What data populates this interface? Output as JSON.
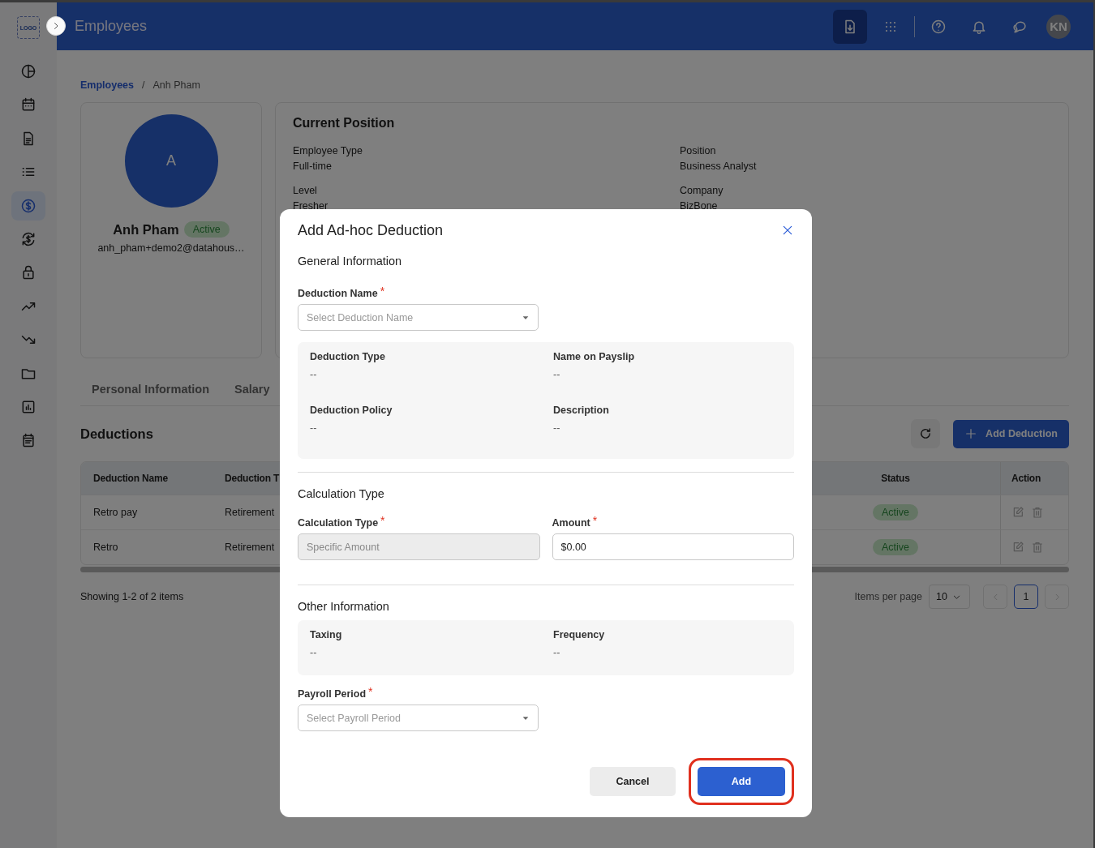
{
  "app": {
    "logo": "LOGO",
    "title": "Employees",
    "avatar": "KN"
  },
  "sidebar": {
    "items": [
      {
        "selected": false
      },
      {
        "selected": false
      },
      {
        "selected": false
      },
      {
        "selected": false
      },
      {
        "selected": true
      },
      {
        "selected": false
      },
      {
        "selected": false
      },
      {
        "selected": false
      },
      {
        "selected": false
      },
      {
        "selected": false
      },
      {
        "selected": false
      },
      {
        "selected": false
      }
    ]
  },
  "breadcrumb": [
    {
      "label": "Employees",
      "kind": "link"
    },
    {
      "label": "/",
      "kind": "separator"
    },
    {
      "label": "Anh Pham",
      "kind": "current"
    }
  ],
  "profile": {
    "initial": "A",
    "name": "Anh Pham",
    "status": "Active",
    "email": "anh_pham+demo2@datahous…"
  },
  "position": {
    "title": "Current Position",
    "fields": [
      {
        "label": "Employee Type",
        "value": "Full-time"
      },
      {
        "label": "Position",
        "value": "Business Analyst"
      },
      {
        "label": "Level",
        "value": "Fresher"
      },
      {
        "label": "Company",
        "value": "BizBone"
      }
    ]
  },
  "tabs": [
    {
      "label": "Personal Information",
      "selected": false
    },
    {
      "label": "Salary",
      "selected": false
    }
  ],
  "deductions": {
    "title": "Deductions",
    "add_button": "Add Deduction",
    "columns": [
      "Deduction Name",
      "Deduction T",
      "Status",
      "Action"
    ],
    "rows": [
      {
        "name": "Retro pay",
        "type": "Retirement",
        "status": "Active"
      },
      {
        "name": "Retro",
        "type": "Retirement",
        "status": "Active"
      }
    ],
    "summary": "Showing 1-2 of 2 items",
    "per_page_label": "Items per page",
    "per_page": "10",
    "pages": [
      {
        "label": "1",
        "selected": true
      }
    ]
  },
  "dialog": {
    "title": "Add Ad-hoc Deduction",
    "sections": [
      {
        "heading": "General Information",
        "blocks": [
          {
            "kind": "field_row",
            "fields": [
              {
                "kind": "select",
                "label": "Deduction Name",
                "mark": "*",
                "placeholder": "Select Deduction Name"
              }
            ]
          },
          {
            "kind": "info_panel",
            "items": [
              {
                "label": "Deduction Type",
                "value": "--"
              },
              {
                "label": "Name on Payslip",
                "value": "--"
              },
              {
                "label": "Deduction Policy",
                "value": "--"
              },
              {
                "label": "Description",
                "value": "--"
              }
            ]
          }
        ]
      },
      {
        "heading": "Calculation Type",
        "blocks": [
          {
            "kind": "field_row",
            "fields": [
              {
                "kind": "input",
                "label": "Calculation Type",
                "mark": "*",
                "value": "Specific Amount",
                "disabled": true
              },
              {
                "kind": "input",
                "label": "Amount",
                "mark": "*",
                "value": "$0.00",
                "disabled": false
              }
            ]
          }
        ]
      },
      {
        "heading": "Other Information",
        "blocks": [
          {
            "kind": "info_panel",
            "items": [
              {
                "label": "Taxing",
                "value": "--"
              },
              {
                "label": "Frequency",
                "value": "--"
              }
            ]
          },
          {
            "kind": "field_row",
            "fields": [
              {
                "kind": "select",
                "label": "Payroll Period",
                "mark": "*",
                "placeholder": "Select Payroll Period"
              }
            ]
          }
        ]
      }
    ],
    "buttons": [
      {
        "label": "Cancel",
        "kind": "secondary",
        "highlighted": false
      },
      {
        "label": "Add",
        "kind": "primary",
        "highlighted": true
      }
    ]
  }
}
